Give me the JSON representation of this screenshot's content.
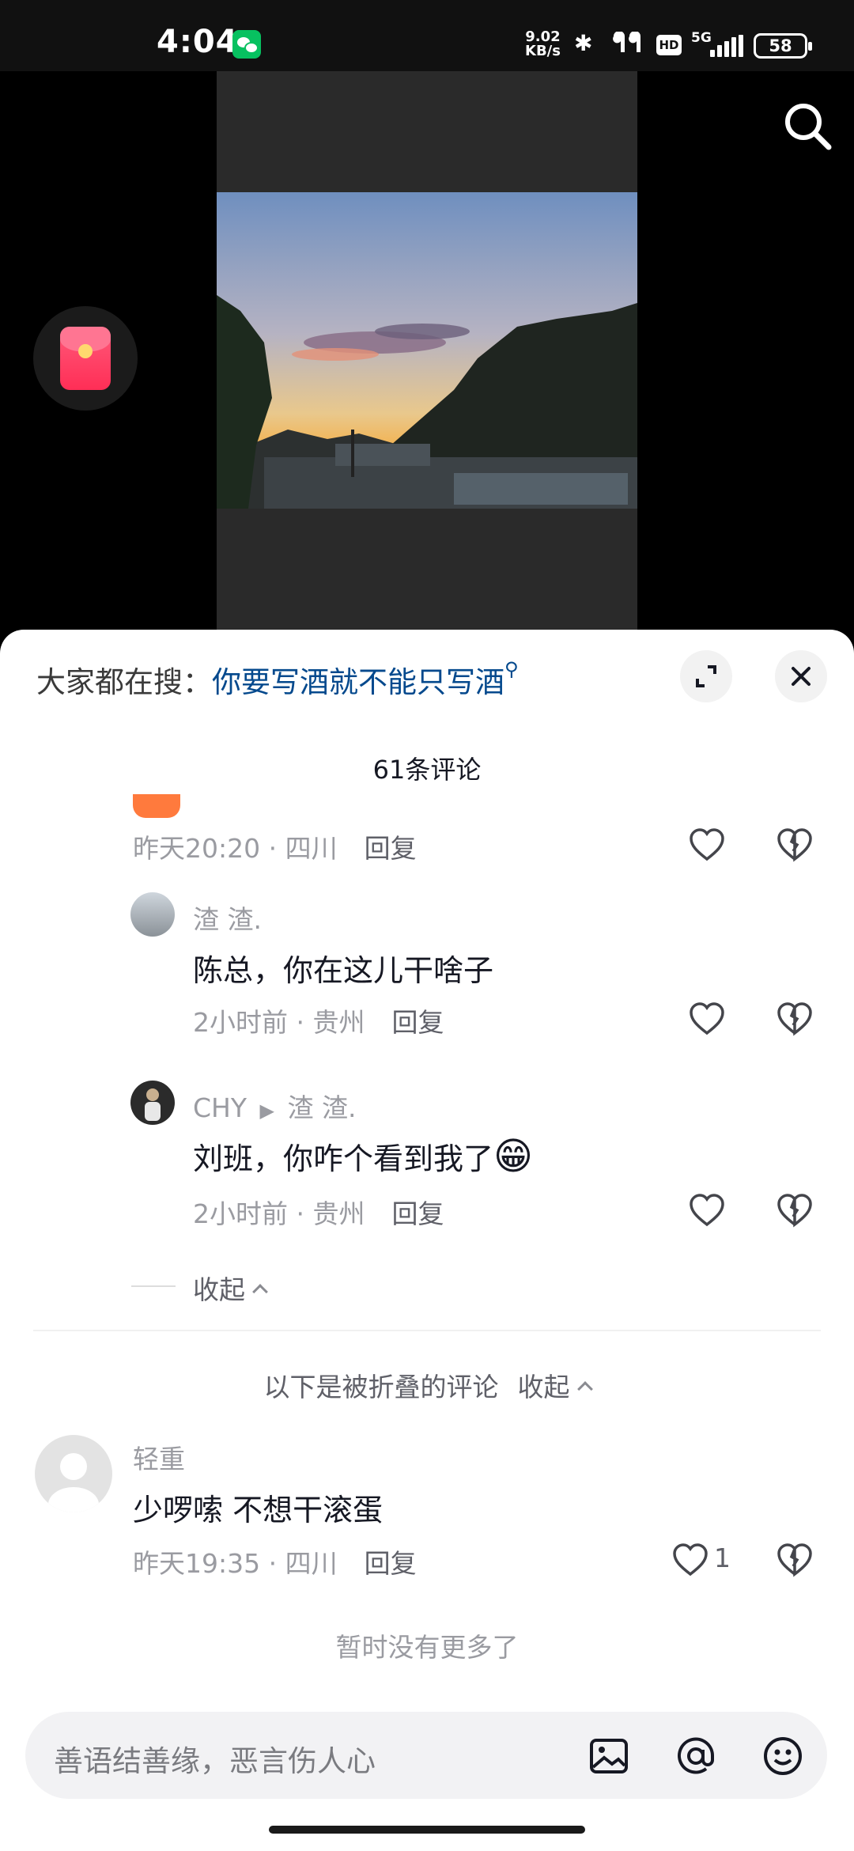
{
  "status_bar": {
    "time": "4:04",
    "net_speed_value": "9.02",
    "net_speed_unit": "KB/s",
    "hd_label": "HD",
    "network_label": "5G",
    "battery": "58"
  },
  "sheet": {
    "hot_search_prefix": "大家都在搜：",
    "hot_search_query": "你要写酒就不能只写酒",
    "comment_count": "61条评论"
  },
  "comments": [
    {
      "time": "昨天20:20",
      "location": "四川",
      "reply": "回复"
    },
    {
      "user": "渣   渣.",
      "text": "陈总，你在这儿干啥子",
      "time": "2小时前",
      "location": "贵州",
      "reply": "回复"
    },
    {
      "user": "CHY",
      "reply_to": "渣   渣.",
      "text": "刘班，你咋个看到我了",
      "emoji": "😁",
      "time": "2小时前",
      "location": "贵州",
      "reply": "回复"
    },
    {
      "user": "轻重",
      "text": "少啰嗦 不想干滚蛋",
      "time": "昨天19:35",
      "location": "四川",
      "reply": "回复",
      "likes": "1"
    }
  ],
  "collapse_label": "收起",
  "folded_note": "以下是被折叠的评论",
  "folded_collapse_label": "收起",
  "no_more": "暂时没有更多了",
  "input": {
    "placeholder": "善语结善缘，恶言伤人心"
  },
  "colors": {
    "accent_link": "#04498d",
    "text_primary": "#161823",
    "text_secondary": "#9a9ba1"
  }
}
